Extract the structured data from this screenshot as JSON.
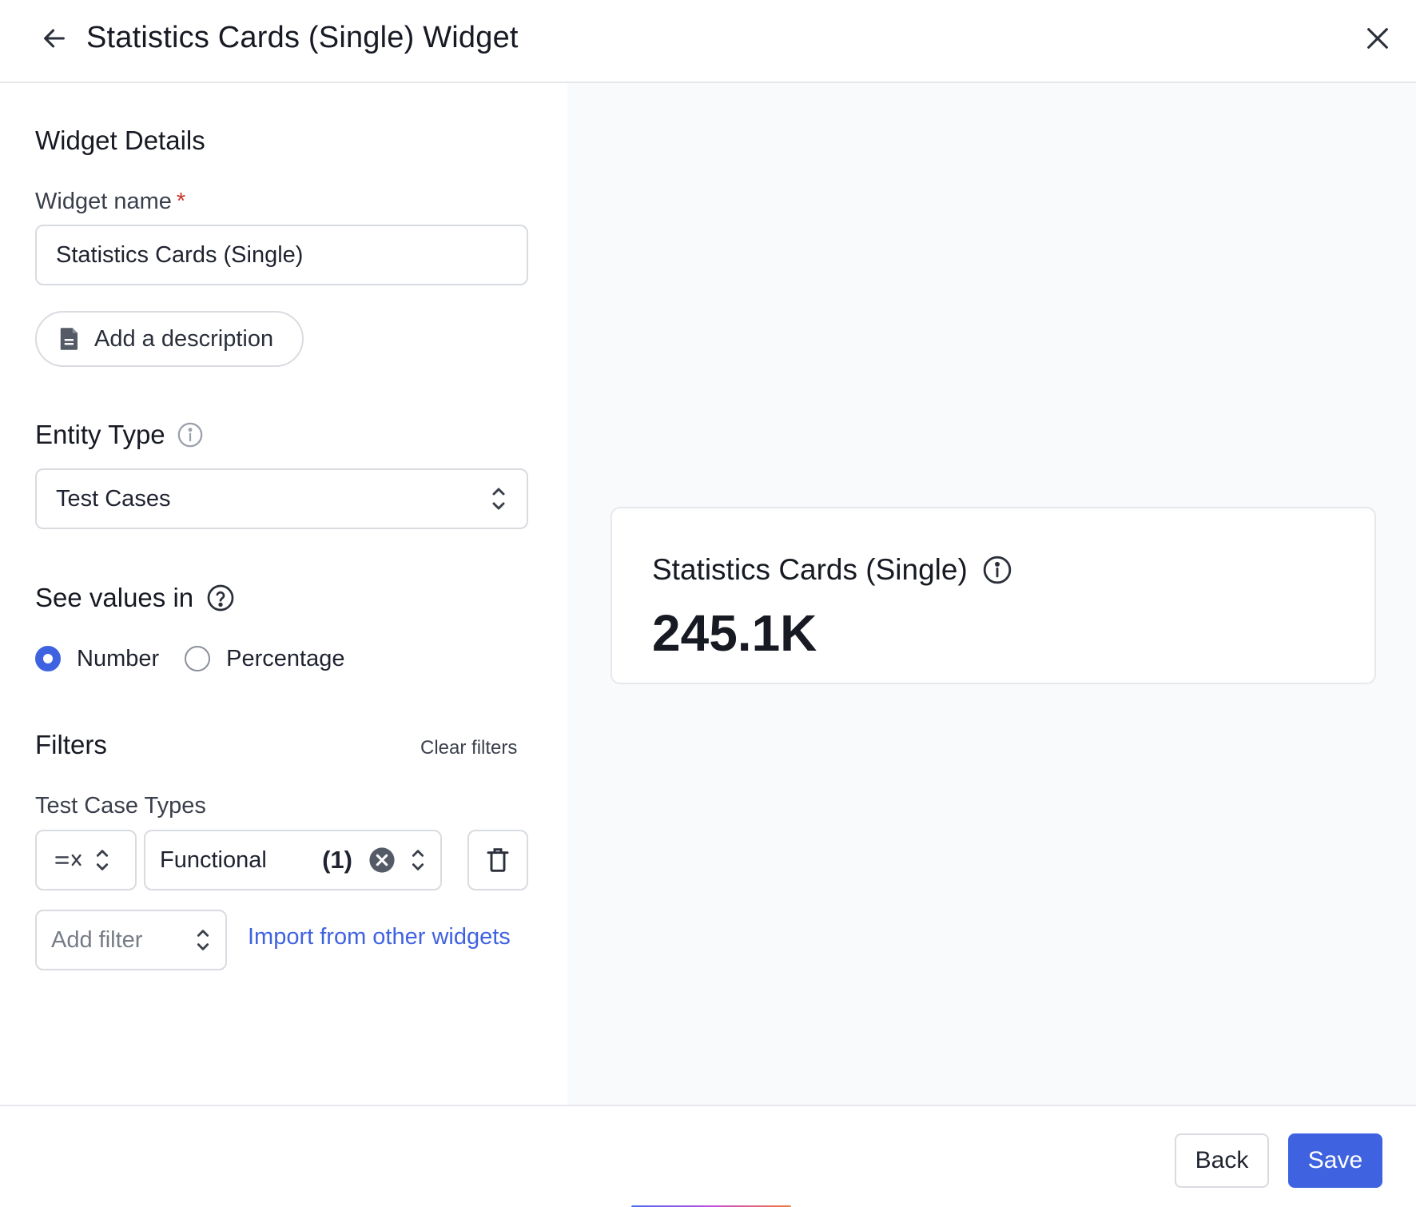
{
  "header": {
    "title": "Statistics Cards (Single) Widget"
  },
  "details": {
    "section_title": "Widget Details",
    "name_label": "Widget name",
    "required_marker": "*",
    "name_value": "Statistics Cards (Single)",
    "add_description_label": "Add a description"
  },
  "entity": {
    "label": "Entity Type",
    "selected": "Test Cases"
  },
  "values_in": {
    "label": "See values in",
    "options": [
      {
        "label": "Number",
        "checked": true
      },
      {
        "label": "Percentage",
        "checked": false
      }
    ]
  },
  "filters": {
    "title": "Filters",
    "clear_label": "Clear filters",
    "group_label": "Test Case Types",
    "filter_value": "Functional",
    "filter_count": "(1)",
    "add_filter_placeholder": "Add filter",
    "import_label": "Import from other widgets"
  },
  "preview": {
    "card_title": "Statistics Cards (Single)",
    "card_value": "245.1K"
  },
  "footer": {
    "back_label": "Back",
    "save_label": "Save"
  },
  "colors": {
    "accent": "#3f63e0",
    "required": "#c8332d",
    "border": "#d8dbe0",
    "preview_bg": "#f9fafb"
  }
}
